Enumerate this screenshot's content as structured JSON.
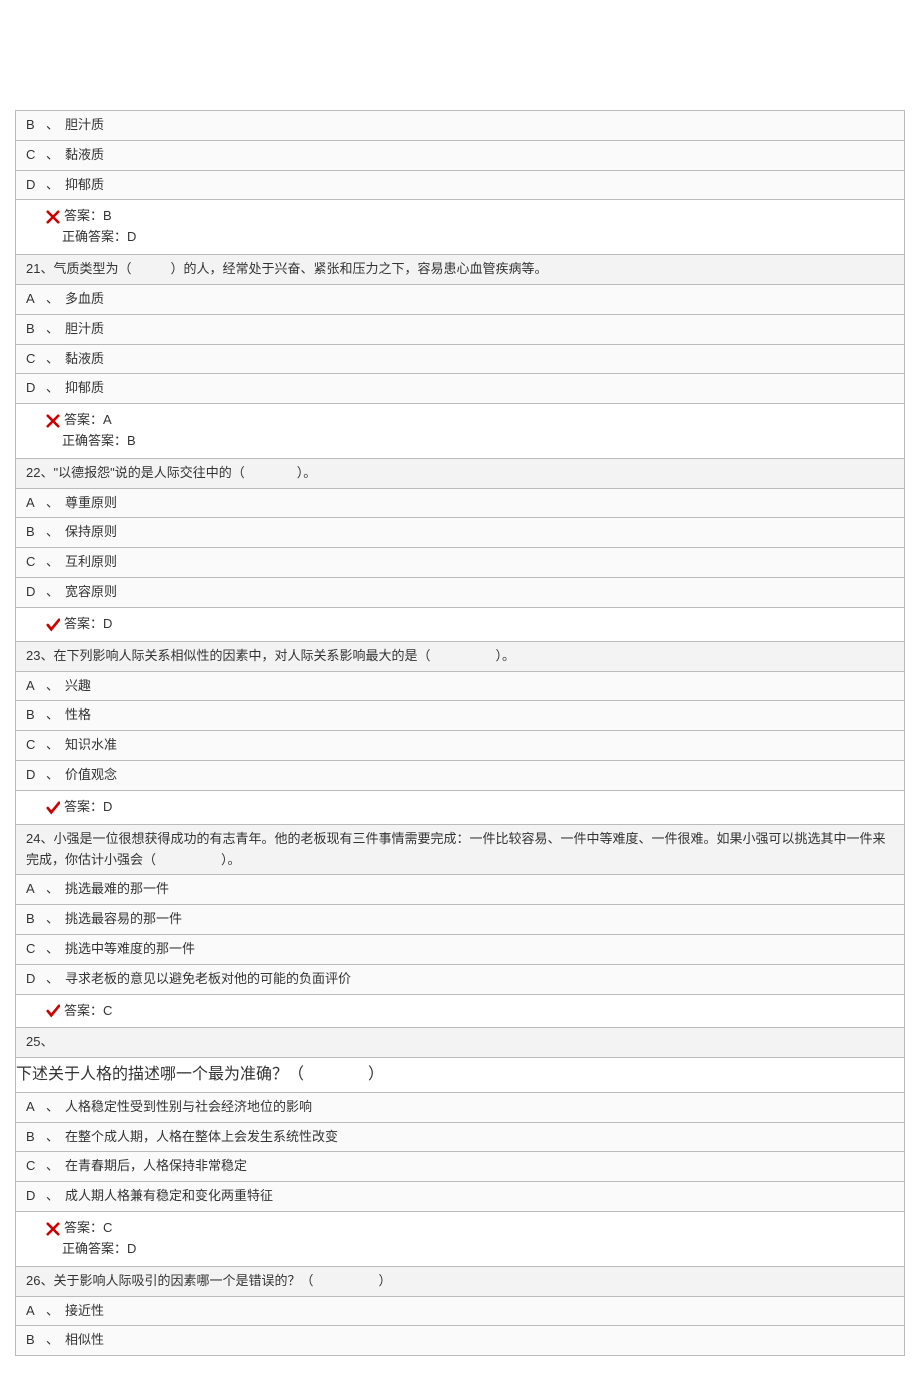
{
  "labels": {
    "sep": "、",
    "answer_prefix": "答案：",
    "correct_prefix": "正确答案："
  },
  "partial_options": [
    {
      "letter": "B",
      "text": "胆汁质"
    },
    {
      "letter": "C",
      "text": "黏液质"
    },
    {
      "letter": "D",
      "text": "抑郁质"
    }
  ],
  "partial_answer": {
    "given": "B",
    "correct": "D",
    "is_correct": false
  },
  "questions": [
    {
      "num": "21",
      "text": "气质类型为（　　　）的人，经常处于兴奋、紧张和压力之下，容易患心血管疾病等。",
      "options": [
        {
          "letter": "A",
          "text": "多血质"
        },
        {
          "letter": "B",
          "text": "胆汁质"
        },
        {
          "letter": "C",
          "text": "黏液质"
        },
        {
          "letter": "D",
          "text": "抑郁质"
        }
      ],
      "answer": {
        "given": "A",
        "correct": "B",
        "is_correct": false
      }
    },
    {
      "num": "22",
      "text": "\"以德报怨\"说的是人际交往中的（　　　　）。",
      "options": [
        {
          "letter": "A",
          "text": "尊重原则"
        },
        {
          "letter": "B",
          "text": "保持原则"
        },
        {
          "letter": "C",
          "text": "互利原则"
        },
        {
          "letter": "D",
          "text": "宽容原则"
        }
      ],
      "answer": {
        "given": "D",
        "correct": null,
        "is_correct": true
      }
    },
    {
      "num": "23",
      "text": "在下列影响人际关系相似性的因素中，对人际关系影响最大的是（　　　　　）。",
      "options": [
        {
          "letter": "A",
          "text": "兴趣"
        },
        {
          "letter": "B",
          "text": "性格"
        },
        {
          "letter": "C",
          "text": "知识水准"
        },
        {
          "letter": "D",
          "text": "价值观念"
        }
      ],
      "answer": {
        "given": "D",
        "correct": null,
        "is_correct": true
      }
    },
    {
      "num": "24",
      "text": "小强是一位很想获得成功的有志青年。他的老板现有三件事情需要完成：一件比较容易、一件中等难度、一件很难。如果小强可以挑选其中一件来完成，你估计小强会（　　　　　）。",
      "options": [
        {
          "letter": "A",
          "text": "挑选最难的那一件"
        },
        {
          "letter": "B",
          "text": "挑选最容易的那一件"
        },
        {
          "letter": "C",
          "text": "挑选中等难度的那一件"
        },
        {
          "letter": "D",
          "text": "寻求老板的意见以避免老板对他的可能的负面评价"
        }
      ],
      "answer": {
        "given": "C",
        "correct": null,
        "is_correct": true
      }
    },
    {
      "num": "25",
      "text": "",
      "extra_text": "下述关于人格的描述哪一个最为准确？（　　　　）",
      "options": [
        {
          "letter": "A",
          "text": "人格稳定性受到性别与社会经济地位的影响"
        },
        {
          "letter": "B",
          "text": "在整个成人期，人格在整体上会发生系统性改变"
        },
        {
          "letter": "C",
          "text": "在青春期后，人格保持非常稳定"
        },
        {
          "letter": "D",
          "text": "成人期人格兼有稳定和变化两重特征"
        }
      ],
      "answer": {
        "given": "C",
        "correct": "D",
        "is_correct": false
      }
    },
    {
      "num": "26",
      "text": "关于影响人际吸引的因素哪一个是错误的？（　　　　　）",
      "options": [
        {
          "letter": "A",
          "text": "接近性"
        },
        {
          "letter": "B",
          "text": "相似性"
        }
      ],
      "answer": null
    }
  ]
}
